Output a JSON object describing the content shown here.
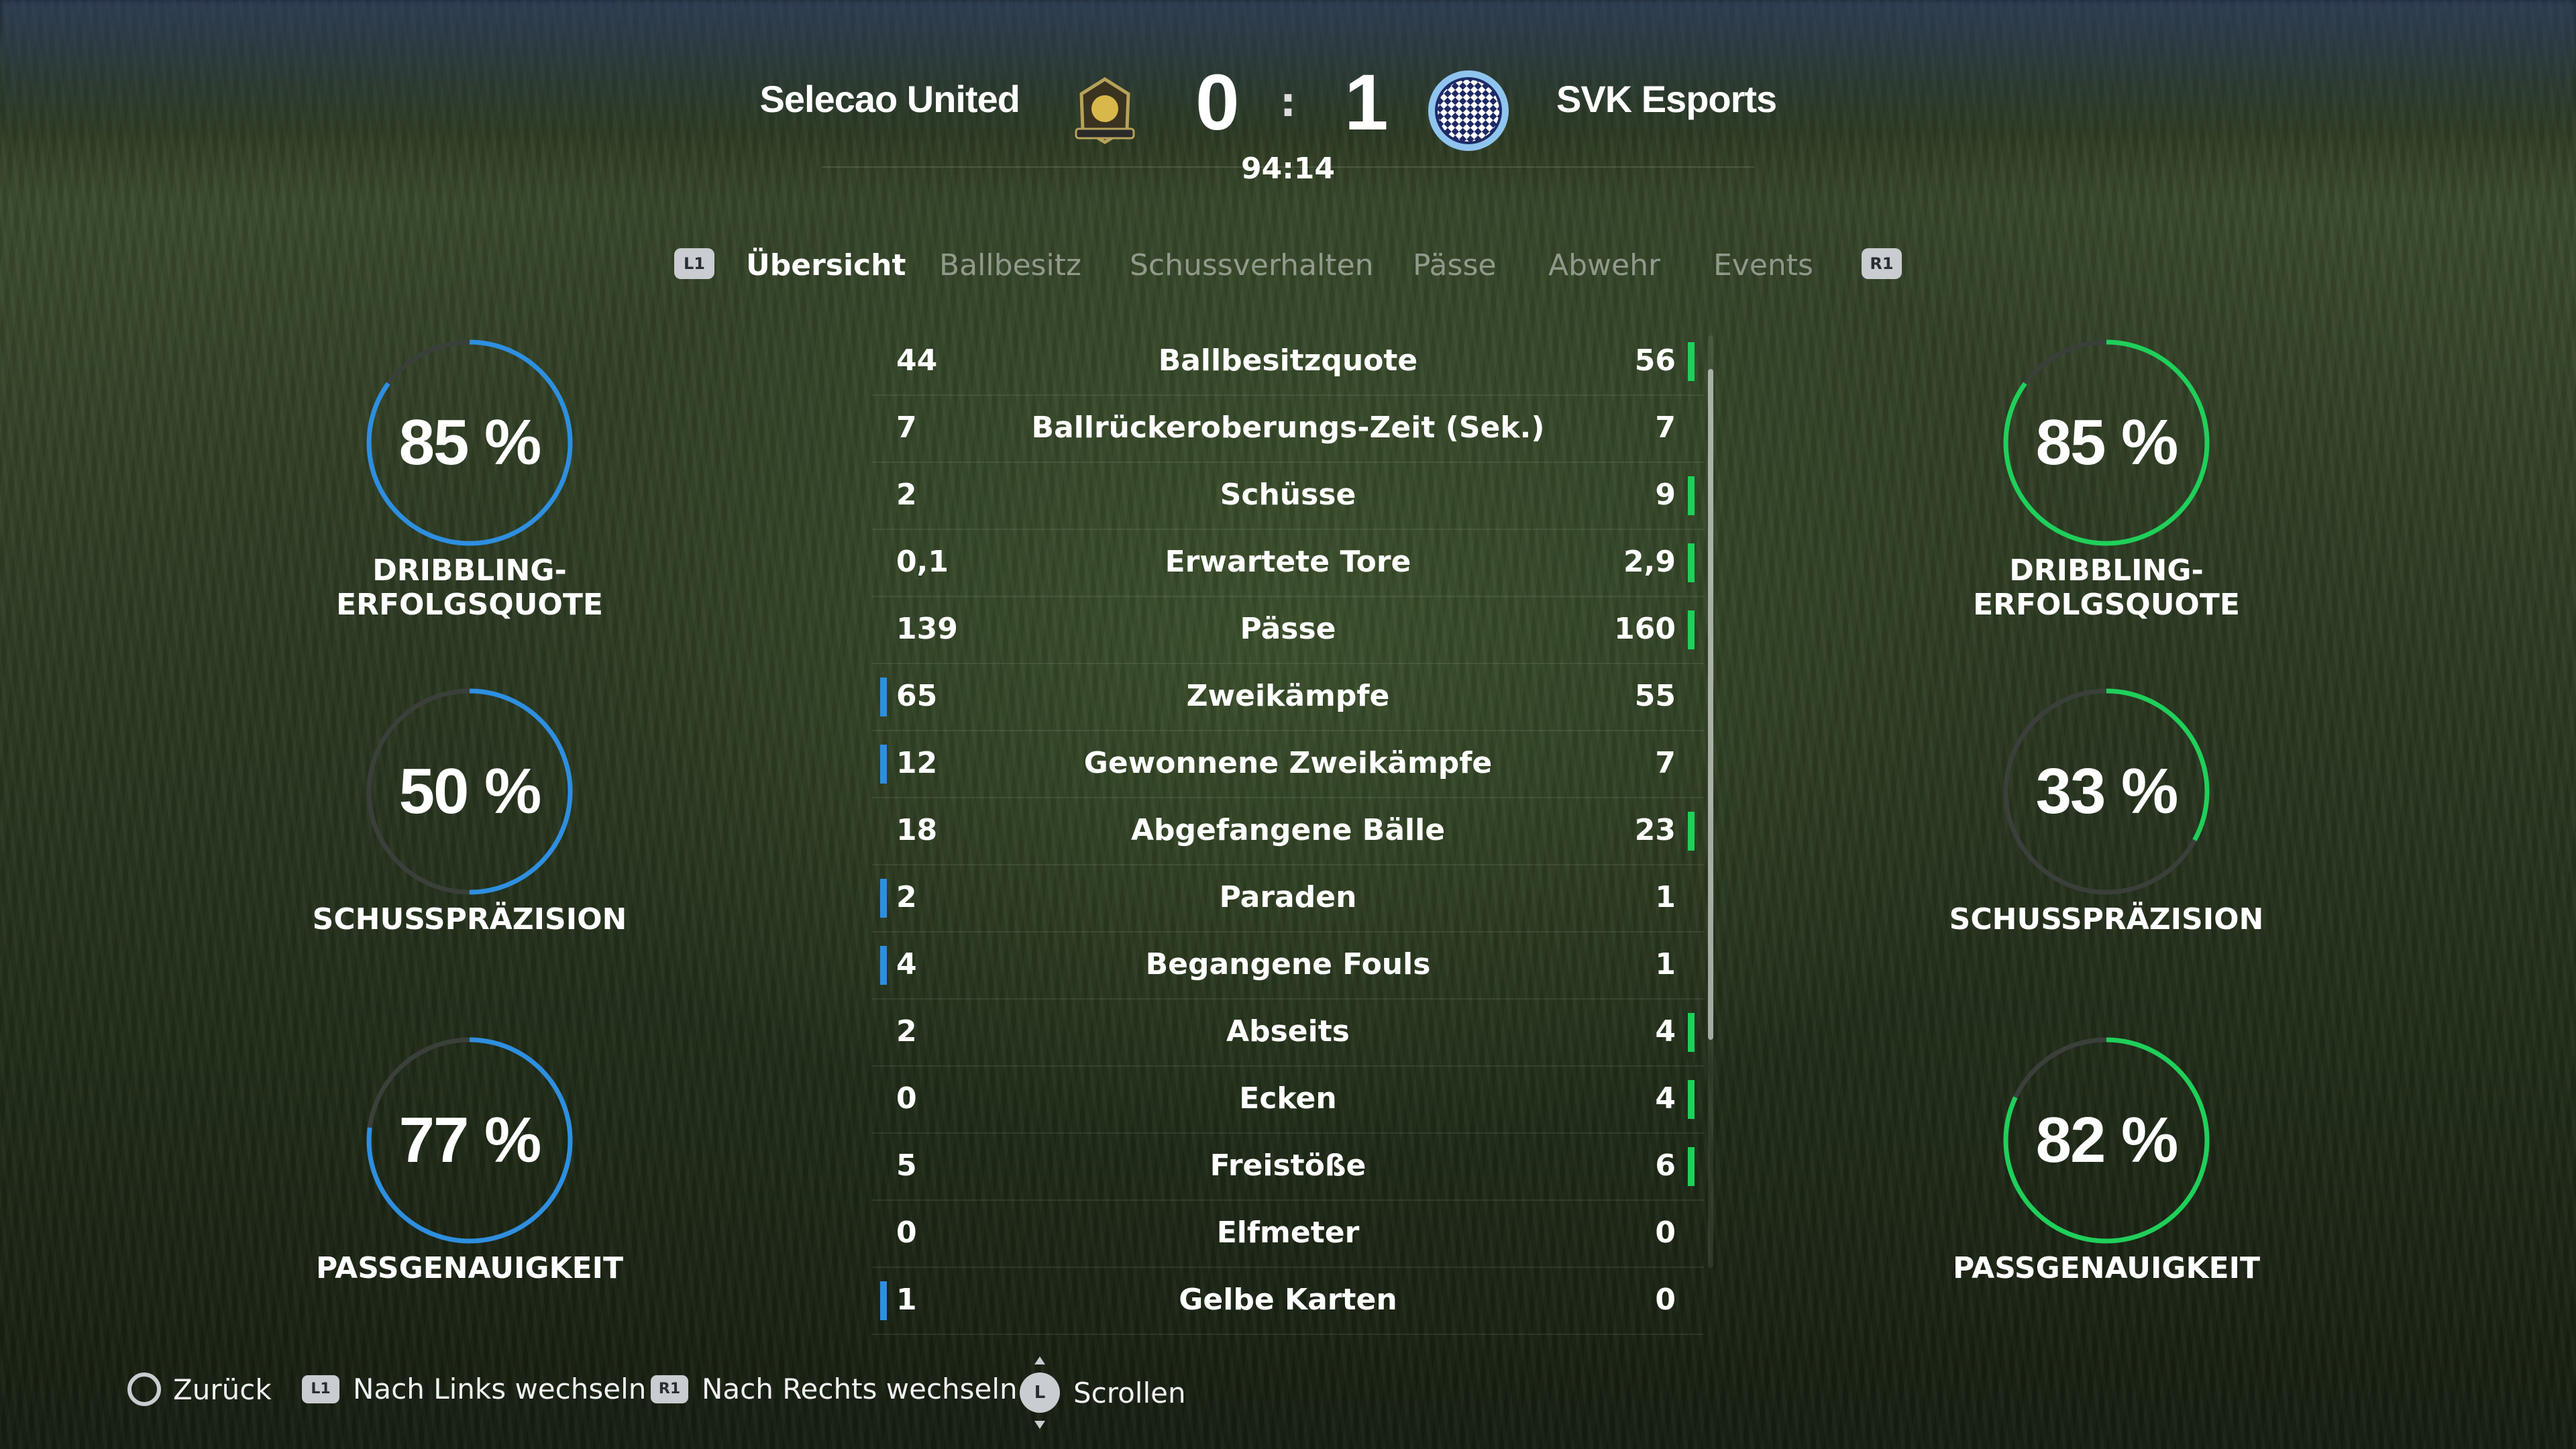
{
  "header": {
    "home_team": "Selecao United",
    "away_team": "SVK Esports",
    "home_score": "0",
    "away_score": "1",
    "separator": ":",
    "clock": "94:14",
    "home_crest_icon": "shield-crest-icon",
    "away_crest_icon": "checkered-circle-crest-icon"
  },
  "tabs": {
    "left_button": "L1",
    "right_button": "R1",
    "items": [
      {
        "label": "Übersicht",
        "active": true
      },
      {
        "label": "Ballbesitz",
        "active": false
      },
      {
        "label": "Schussverhalten",
        "active": false
      },
      {
        "label": "Pässe",
        "active": false
      },
      {
        "label": "Abwehr",
        "active": false
      },
      {
        "label": "Events",
        "active": false
      }
    ]
  },
  "colors": {
    "home": "#2e8fe0",
    "away": "#1fd05a",
    "ring_track": "#3a3f3a"
  },
  "home_rings": [
    {
      "value": "85 %",
      "fraction": 0.85,
      "label": "DRIBBLING-ERFOLGSQUOTE"
    },
    {
      "value": "50 %",
      "fraction": 0.5,
      "label": "SCHUSSPRÄZISION"
    },
    {
      "value": "77 %",
      "fraction": 0.77,
      "label": "PASSGENAUIGKEIT"
    }
  ],
  "away_rings": [
    {
      "value": "85 %",
      "fraction": 0.85,
      "label": "DRIBBLING-ERFOLGSQUOTE"
    },
    {
      "value": "33 %",
      "fraction": 0.33,
      "label": "SCHUSSPRÄZISION"
    },
    {
      "value": "82 %",
      "fraction": 0.82,
      "label": "PASSGENAUIGKEIT"
    }
  ],
  "stats": [
    {
      "home": "44",
      "label": "Ballbesitzquote",
      "away": "56",
      "leader": "away"
    },
    {
      "home": "7",
      "label": "Ballrückeroberungs-Zeit (Sek.)",
      "away": "7",
      "leader": "none"
    },
    {
      "home": "2",
      "label": "Schüsse",
      "away": "9",
      "leader": "away"
    },
    {
      "home": "0,1",
      "label": "Erwartete Tore",
      "away": "2,9",
      "leader": "away"
    },
    {
      "home": "139",
      "label": "Pässe",
      "away": "160",
      "leader": "away"
    },
    {
      "home": "65",
      "label": "Zweikämpfe",
      "away": "55",
      "leader": "home"
    },
    {
      "home": "12",
      "label": "Gewonnene Zweikämpfe",
      "away": "7",
      "leader": "home"
    },
    {
      "home": "18",
      "label": "Abgefangene Bälle",
      "away": "23",
      "leader": "away"
    },
    {
      "home": "2",
      "label": "Paraden",
      "away": "1",
      "leader": "home"
    },
    {
      "home": "4",
      "label": "Begangene Fouls",
      "away": "1",
      "leader": "home"
    },
    {
      "home": "2",
      "label": "Abseits",
      "away": "4",
      "leader": "away"
    },
    {
      "home": "0",
      "label": "Ecken",
      "away": "4",
      "leader": "away"
    },
    {
      "home": "5",
      "label": "Freistöße",
      "away": "6",
      "leader": "away"
    },
    {
      "home": "0",
      "label": "Elfmeter",
      "away": "0",
      "leader": "none"
    },
    {
      "home": "1",
      "label": "Gelbe Karten",
      "away": "0",
      "leader": "home"
    }
  ],
  "footer": {
    "back": "Zurück",
    "left_badge": "L1",
    "left": "Nach Links wechseln",
    "right_badge": "R1",
    "right": "Nach Rechts wechseln",
    "stick_badge": "L",
    "scroll": "Scrollen"
  }
}
